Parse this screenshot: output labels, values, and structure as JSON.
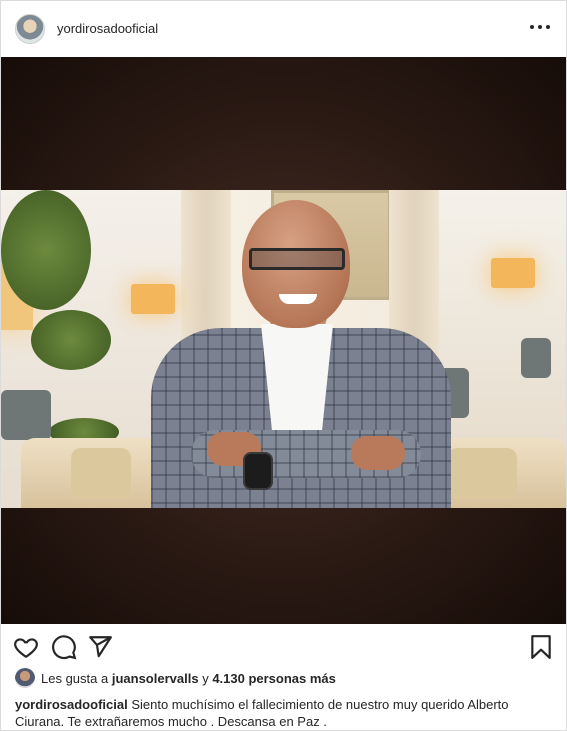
{
  "post": {
    "username": "yordirosadooficial",
    "more_icon": "more-horizontal-icon"
  },
  "actions": {
    "icons": [
      "heart-icon",
      "comment-icon",
      "share-icon",
      "bookmark-icon"
    ]
  },
  "likes": {
    "prefix": "Les gusta a",
    "user": "juansolervalls",
    "connector": "y",
    "count": "4.130 personas más"
  },
  "caption": {
    "username": "yordirosadooficial",
    "text": "Siento muchísimo el fallecimiento de nuestro muy querido Alberto Ciurana. Te extrañaremos mucho . Descansa en Paz ."
  },
  "colors": {
    "text": "#262626",
    "border": "#dbdbdb",
    "media_bg": "#2b1a14"
  }
}
